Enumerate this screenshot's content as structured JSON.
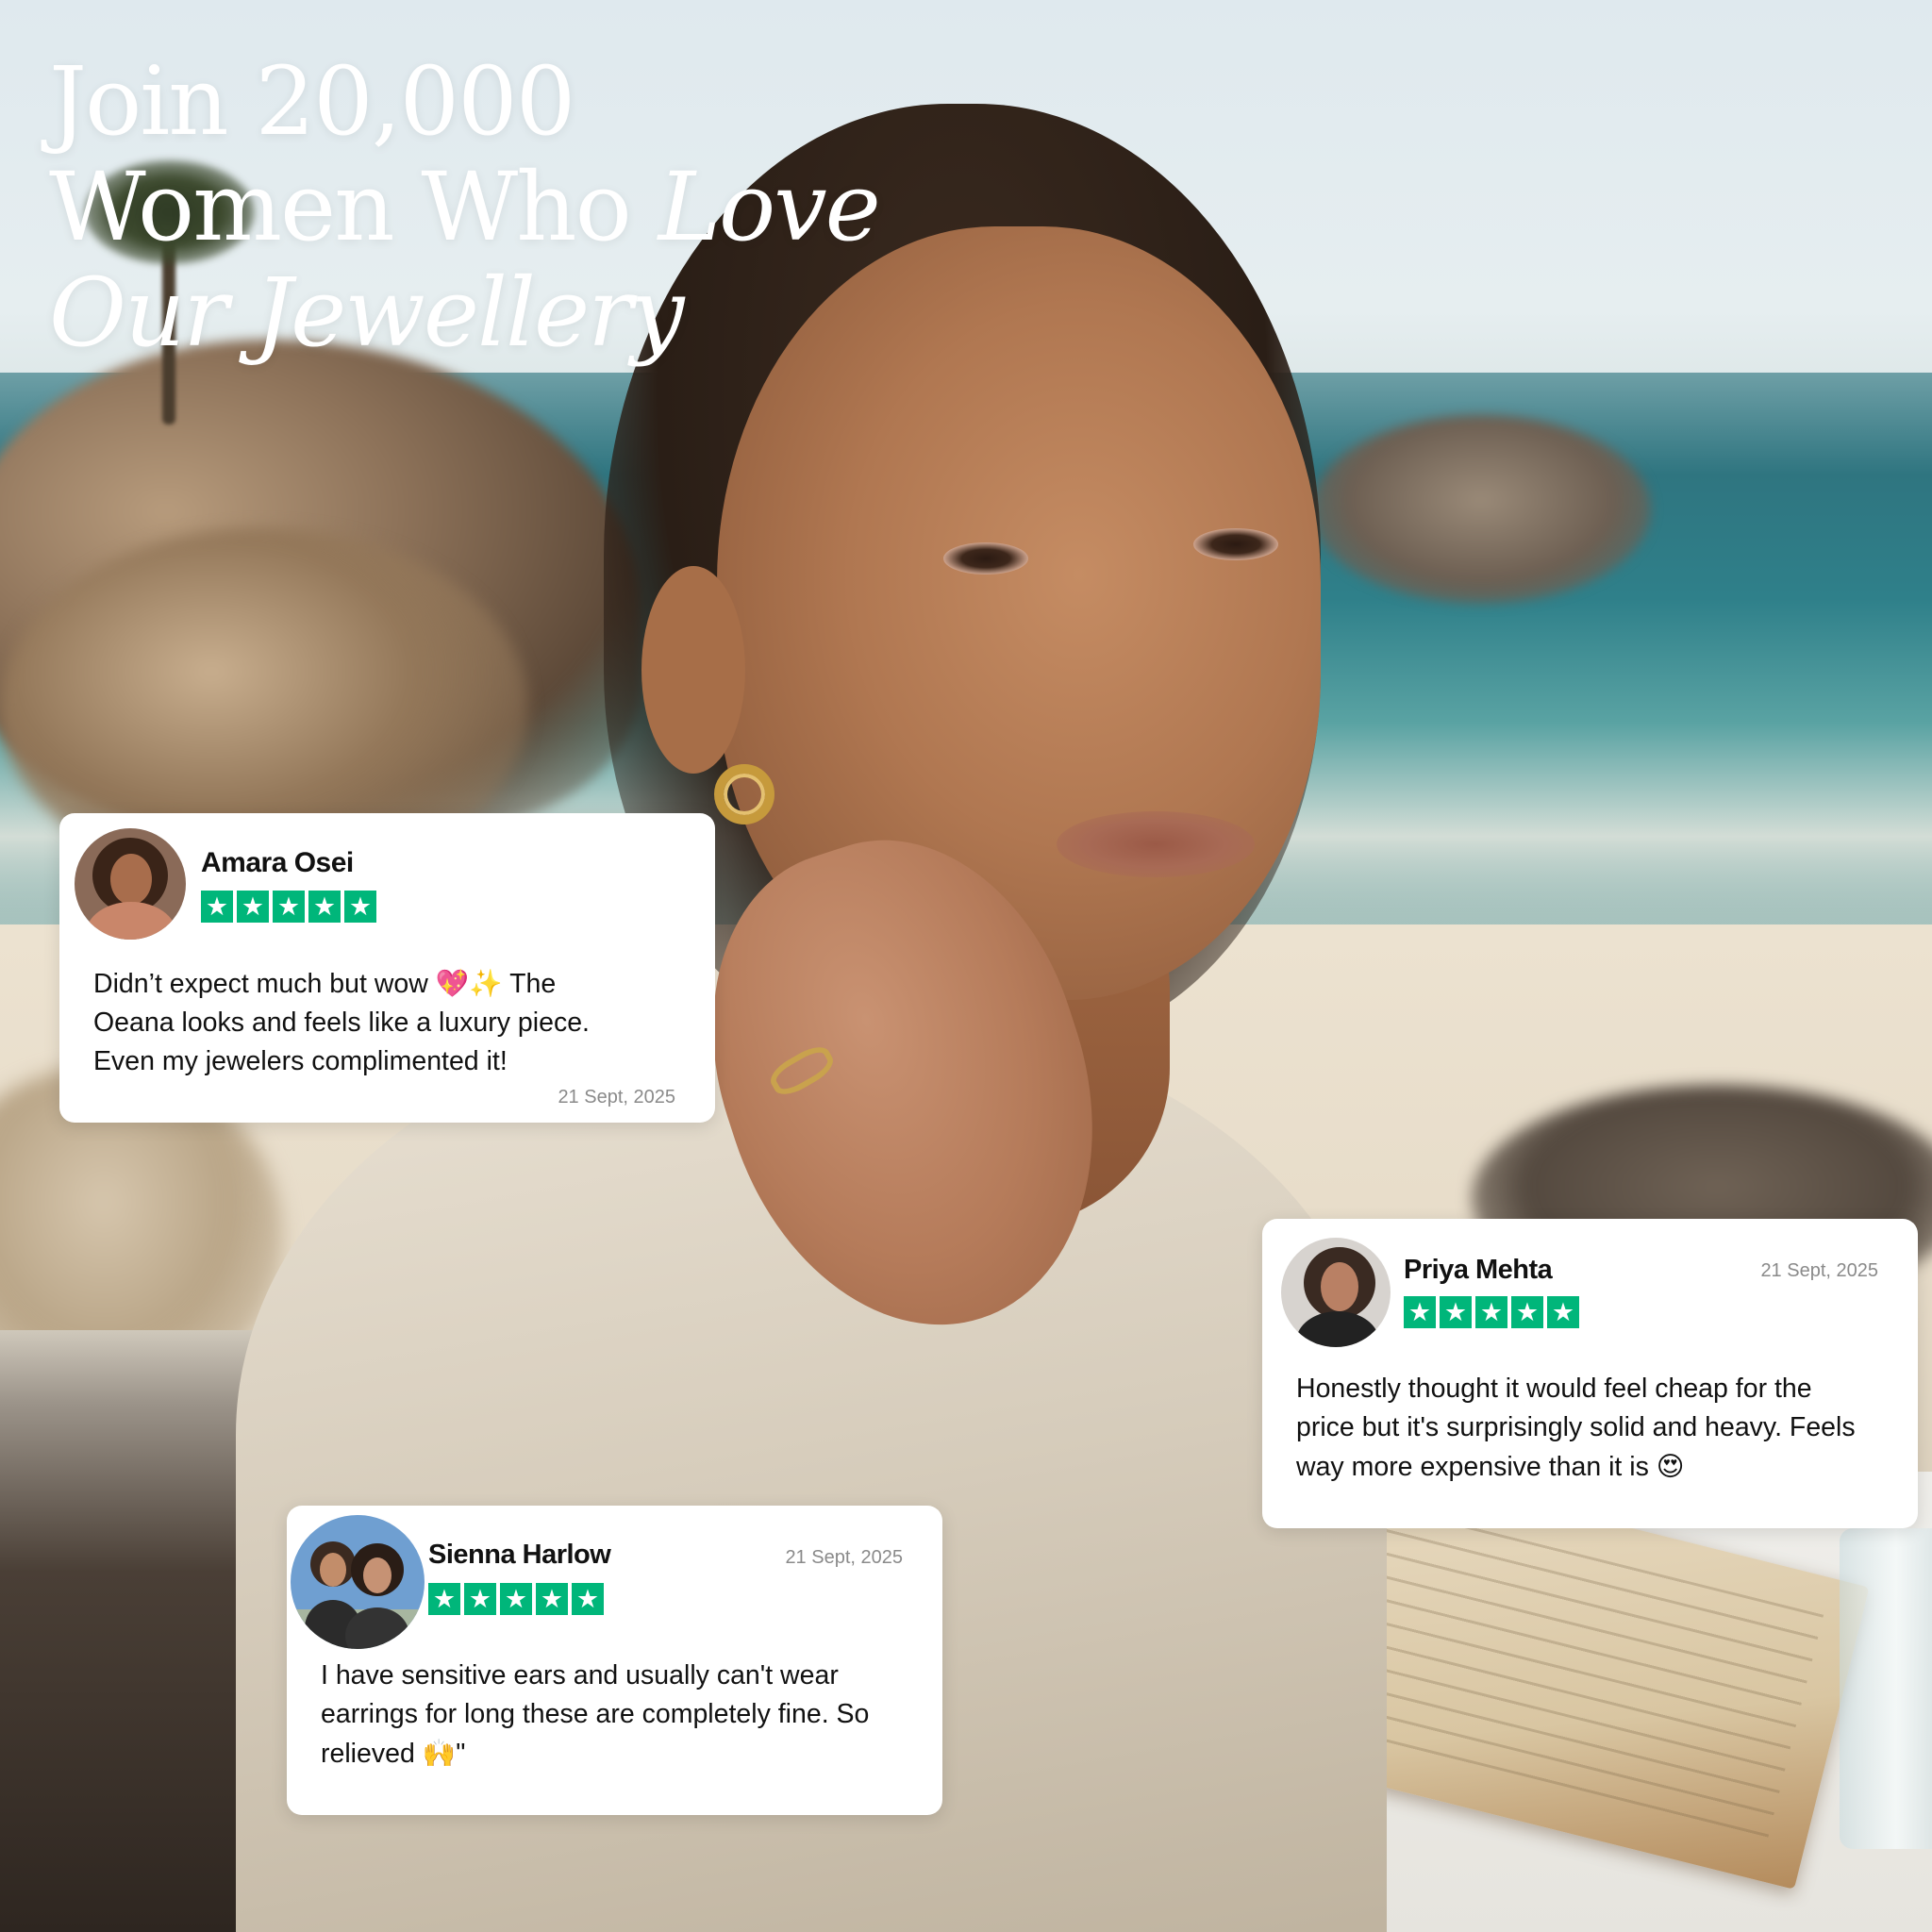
{
  "heading": {
    "line1": "Join 20,000",
    "line2_plain": "Women Who ",
    "line2_italic": "Love",
    "line3_italic": "Our Jewellery"
  },
  "rating_color": "#00b67a",
  "reviews": [
    {
      "name": "Amara Osei",
      "stars": 5,
      "text_before": "Didn’t expect much but wow ",
      "emoji": "💖✨",
      "text_after": " The Oeana looks and feels like a luxury piece. Even my jewelers complimented it!",
      "date": "21 Sept, 2025"
    },
    {
      "name": "Priya Mehta",
      "stars": 5,
      "text_before": "Honestly thought it would feel cheap for the price but it's surprisingly solid and heavy. Feels way more expensive than it is ",
      "emoji": "😍",
      "text_after": "",
      "date": "21 Sept, 2025"
    },
    {
      "name": "Sienna Harlow",
      "stars": 5,
      "text_before": "I have sensitive ears and usually can't wear earrings for long these are completely fine. So relieved ",
      "emoji": "🙌",
      "text_after": "\"",
      "date": "21 Sept, 2025"
    }
  ]
}
